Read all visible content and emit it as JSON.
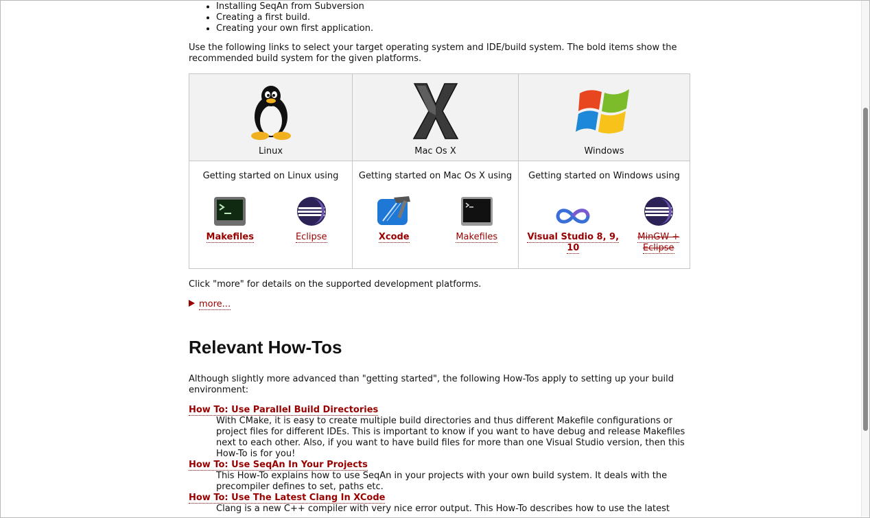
{
  "top_list": [
    "Installing SeqAn from Subversion",
    "Creating a first build.",
    "Creating your own first application."
  ],
  "intro": "Use the following links to select your target operating system and IDE/build system. The bold items show the recommended build system for the given platforms.",
  "platforms": [
    {
      "name": "Linux",
      "getting_started": "Getting started on Linux using",
      "tools": [
        {
          "label": "Makefiles",
          "bold": true,
          "icon": "terminal-icon"
        },
        {
          "label": "Eclipse",
          "bold": false,
          "icon": "eclipse-icon"
        }
      ]
    },
    {
      "name": "Mac Os X",
      "getting_started": "Getting started on Mac Os X using",
      "tools": [
        {
          "label": "Xcode",
          "bold": true,
          "icon": "xcode-icon"
        },
        {
          "label": "Makefiles",
          "bold": false,
          "icon": "terminal-icon"
        }
      ]
    },
    {
      "name": "Windows",
      "getting_started": "Getting started on Windows using",
      "tools": [
        {
          "label": "Visual Studio 8, 9, 10",
          "bold": true,
          "icon": "visual-studio-icon"
        },
        {
          "label": "MinGW + Eclipse",
          "bold": false,
          "strike": true,
          "icon": "eclipse-icon"
        }
      ]
    }
  ],
  "click_more": "Click \"more\" for details on the supported development platforms.",
  "more_link": "more...",
  "howtos_heading": "Relevant How-Tos",
  "howtos_intro": "Although slightly more advanced than \"getting started\", the following How-Tos apply to setting up your build environment:",
  "howtos": [
    {
      "title": "How To: Use Parallel Build Directories",
      "desc": "With CMake, it is easy to create multiple build directories and thus different Makefile configurations or project files for different IDEs. This is important to know if you want to have debug and release Makefiles next to each other. Also, if you want to have build files for more than one Visual Studio version, then this How-To is for you!"
    },
    {
      "title": "How To: Use SeqAn In Your Projects",
      "desc": "This How-To explains how to use SeqAn in your projects with your own build system. It deals with the precompiler defines to set, paths etc."
    },
    {
      "title": "How To: Use The Latest Clang In XCode",
      "desc": "Clang is a new C++ compiler with very nice error output. This How-To describes how to use the latest"
    }
  ],
  "colors": {
    "link": "#990000",
    "header_bg": "#f2f2f2",
    "border": "#c6c6c6"
  }
}
